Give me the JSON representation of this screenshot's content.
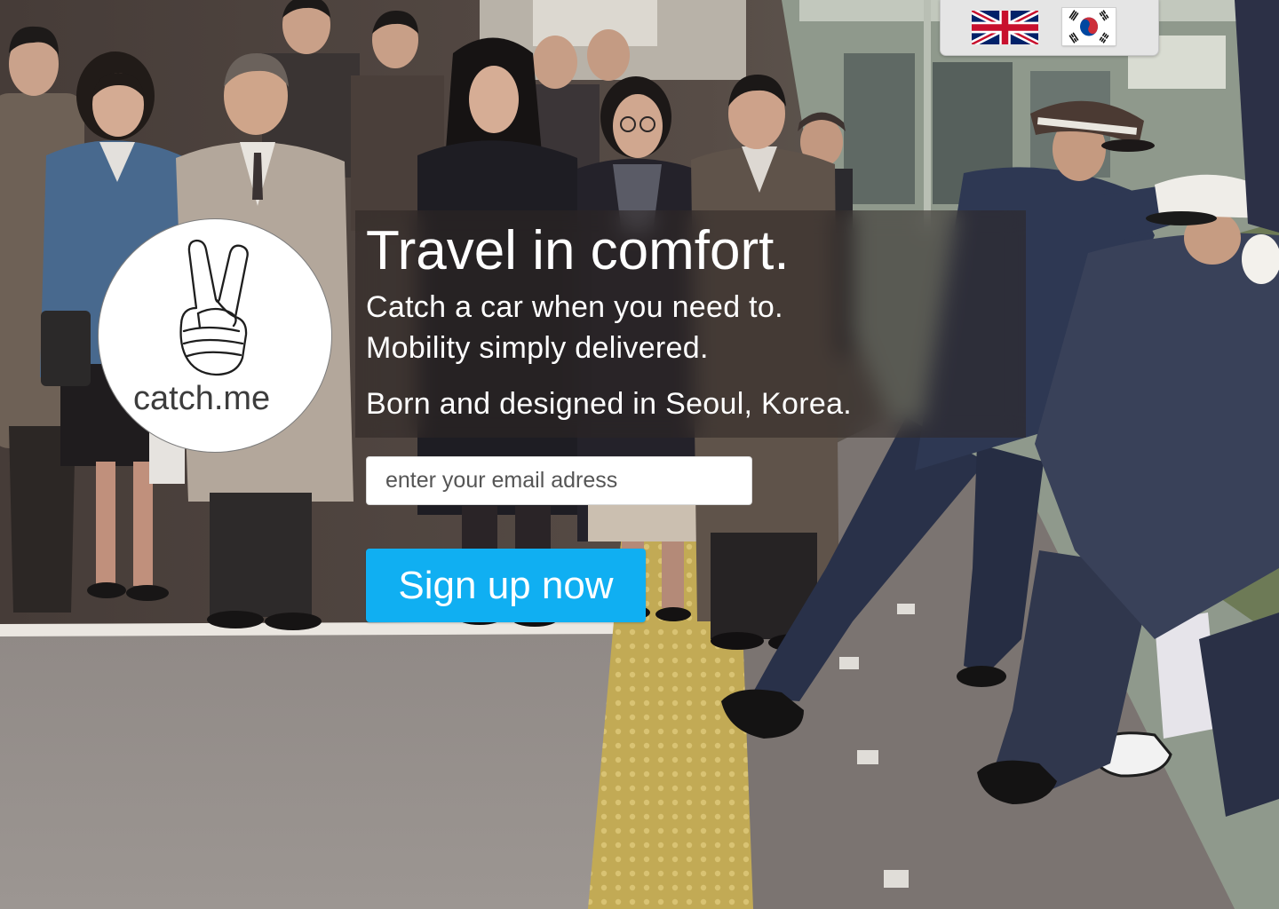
{
  "language_switcher": {
    "flags": [
      {
        "icon": "uk-flag-icon"
      },
      {
        "icon": "korea-flag-icon"
      }
    ]
  },
  "logo": {
    "icon": "peace-hand-icon",
    "text": "catch.me"
  },
  "hero": {
    "title": "Travel in comfort.",
    "lines": [
      "Catch a car when you need to.",
      "Mobility simply delivered."
    ],
    "origin": "Born and designed in Seoul, Korea."
  },
  "signup": {
    "email_placeholder": "enter your email adress",
    "button_label": "Sign up now"
  },
  "colors": {
    "accent": "#10aff2",
    "panel": "rgba(46, 39, 37, 0.55)",
    "text": "#ffffff"
  }
}
